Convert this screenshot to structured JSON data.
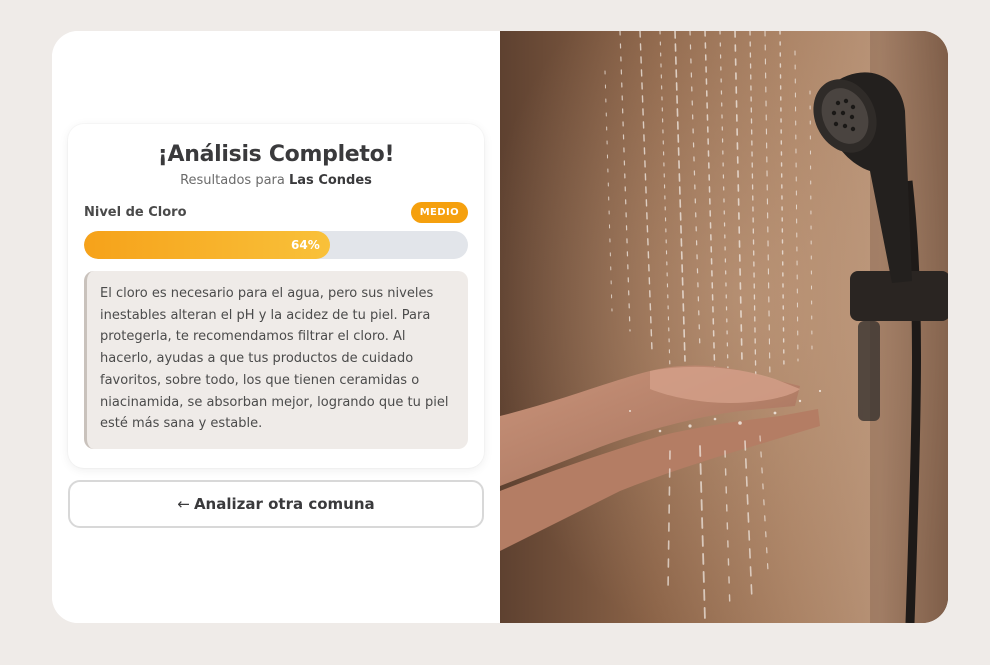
{
  "result": {
    "title": "¡Análisis Completo!",
    "subtitle_prefix": "Resultados para",
    "location": "Las Condes"
  },
  "chlorine": {
    "label": "Nivel de Cloro",
    "level_badge": "MEDIO",
    "percent_text": "64%",
    "percent_value": 64,
    "badge_color": "#f5a00e"
  },
  "info": {
    "text": "El cloro es necesario para el agua, pero sus niveles inestables alteran el pH y la acidez de tu piel. Para protegerla, te recomendamos filtrar el cloro. Al hacerlo, ayudas a que tus productos de cuidado favoritos, sobre todo, los que tienen ceramidas o niacinamida, se absorban mejor, logrando que tu piel esté más sana y estable."
  },
  "actions": {
    "analyze_again_arrow": "←",
    "analyze_again_label": "Analizar otra comuna"
  },
  "image": {
    "subject": "hands-under-shower-photo"
  }
}
